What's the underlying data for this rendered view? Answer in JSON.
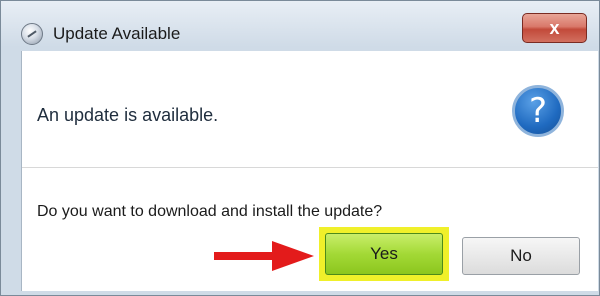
{
  "window": {
    "title": "Update Available",
    "icon": "globe-app-icon",
    "close_label": "x"
  },
  "message": {
    "main": "An update is available.",
    "icon": "question-mark-icon",
    "icon_glyph": "?",
    "prompt": "Do you want to download and install the update?"
  },
  "buttons": {
    "yes_label": "Yes",
    "no_label": "No"
  },
  "annotation": {
    "arrow_color": "#e31b1b",
    "highlight_color": "#f0f02a"
  },
  "colors": {
    "yes_button": "#a3d936",
    "close_button": "#c24a3a",
    "question_icon": "#1f6ac0"
  }
}
